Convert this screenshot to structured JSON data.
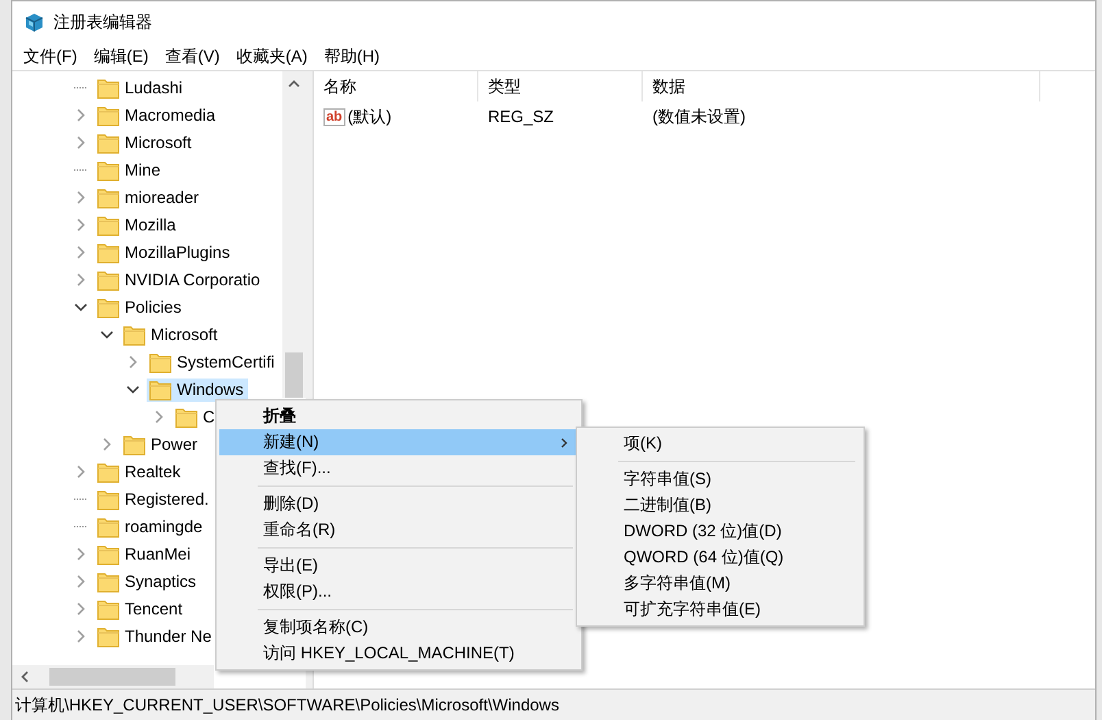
{
  "window": {
    "title": "注册表编辑器"
  },
  "menu_bar": [
    "文件(F)",
    "编辑(E)",
    "查看(V)",
    "收藏夹(A)",
    "帮助(H)"
  ],
  "tree": [
    {
      "name": "Ludashi",
      "has_children": false,
      "selected": false
    },
    {
      "name": "Macromedia",
      "has_children": true,
      "expanded": false,
      "selected": false
    },
    {
      "name": "Microsoft",
      "has_children": true,
      "expanded": false,
      "selected": false
    },
    {
      "name": "Mine",
      "has_children": false,
      "selected": false
    },
    {
      "name": "mioreader",
      "has_children": true,
      "expanded": false,
      "selected": false
    },
    {
      "name": "Mozilla",
      "has_children": true,
      "expanded": false,
      "selected": false
    },
    {
      "name": "MozillaPlugins",
      "has_children": true,
      "expanded": false,
      "selected": false
    },
    {
      "name": "NVIDIA Corporatio",
      "has_children": true,
      "expanded": false,
      "selected": false
    },
    {
      "name": "Policies",
      "has_children": true,
      "expanded": true,
      "selected": false,
      "children": [
        {
          "name": "Microsoft",
          "has_children": true,
          "expanded": true,
          "selected": false,
          "children": [
            {
              "name": "SystemCertifi",
              "has_children": true,
              "expanded": false,
              "selected": false
            },
            {
              "name": "Windows",
              "has_children": true,
              "expanded": true,
              "selected": true,
              "children": [
                {
                  "name": "C",
                  "has_children": true,
                  "expanded": false,
                  "selected": false
                }
              ]
            }
          ]
        },
        {
          "name": "Power",
          "has_children": true,
          "expanded": false,
          "selected": false
        }
      ]
    },
    {
      "name": "Realtek",
      "has_children": true,
      "expanded": false,
      "selected": false
    },
    {
      "name": "Registered.",
      "has_children": false,
      "selected": false
    },
    {
      "name": "roamingde",
      "has_children": false,
      "selected": false
    },
    {
      "name": "RuanMei",
      "has_children": true,
      "expanded": false,
      "selected": false
    },
    {
      "name": "Synaptics",
      "has_children": true,
      "expanded": false,
      "selected": false
    },
    {
      "name": "Tencent",
      "has_children": true,
      "expanded": false,
      "selected": false
    },
    {
      "name": "Thunder Ne",
      "has_children": true,
      "expanded": false,
      "selected": false
    }
  ],
  "values": {
    "columns": [
      "名称",
      "类型",
      "数据"
    ],
    "rows": [
      {
        "icon": "ab",
        "name": "(默认)",
        "type": "REG_SZ",
        "data": "(数值未设置)"
      }
    ]
  },
  "status_bar": "计算机\\HKEY_CURRENT_USER\\SOFTWARE\\Policies\\Microsoft\\Windows",
  "context_menu": [
    {
      "kind": "item",
      "label": "折叠",
      "default": true,
      "selected": false,
      "submenu": false
    },
    {
      "kind": "item",
      "label": "新建(N)",
      "default": false,
      "selected": true,
      "submenu": true
    },
    {
      "kind": "item",
      "label": "查找(F)...",
      "default": false,
      "selected": false,
      "submenu": false
    },
    {
      "kind": "separator"
    },
    {
      "kind": "item",
      "label": "删除(D)",
      "default": false,
      "selected": false,
      "submenu": false
    },
    {
      "kind": "item",
      "label": "重命名(R)",
      "default": false,
      "selected": false,
      "submenu": false
    },
    {
      "kind": "separator"
    },
    {
      "kind": "item",
      "label": "导出(E)",
      "default": false,
      "selected": false,
      "submenu": false
    },
    {
      "kind": "item",
      "label": "权限(P)...",
      "default": false,
      "selected": false,
      "submenu": false
    },
    {
      "kind": "separator"
    },
    {
      "kind": "item",
      "label": "复制项名称(C)",
      "default": false,
      "selected": false,
      "submenu": false
    },
    {
      "kind": "item",
      "label": "访问 HKEY_LOCAL_MACHINE(T)",
      "default": false,
      "selected": false,
      "submenu": false
    }
  ],
  "submenu": [
    {
      "kind": "item",
      "label": "项(K)",
      "default": false,
      "selected": false,
      "submenu": false
    },
    {
      "kind": "separator"
    },
    {
      "kind": "item",
      "label": "字符串值(S)",
      "default": false,
      "selected": false,
      "submenu": false
    },
    {
      "kind": "item",
      "label": "二进制值(B)",
      "default": false,
      "selected": false,
      "submenu": false
    },
    {
      "kind": "item",
      "label": "DWORD (32 位)值(D)",
      "default": false,
      "selected": false,
      "submenu": false
    },
    {
      "kind": "item",
      "label": "QWORD (64 位)值(Q)",
      "default": false,
      "selected": false,
      "submenu": false
    },
    {
      "kind": "item",
      "label": "多字符串值(M)",
      "default": false,
      "selected": false,
      "submenu": false
    },
    {
      "kind": "item",
      "label": "可扩充字符串值(E)",
      "default": false,
      "selected": false,
      "submenu": false
    }
  ]
}
